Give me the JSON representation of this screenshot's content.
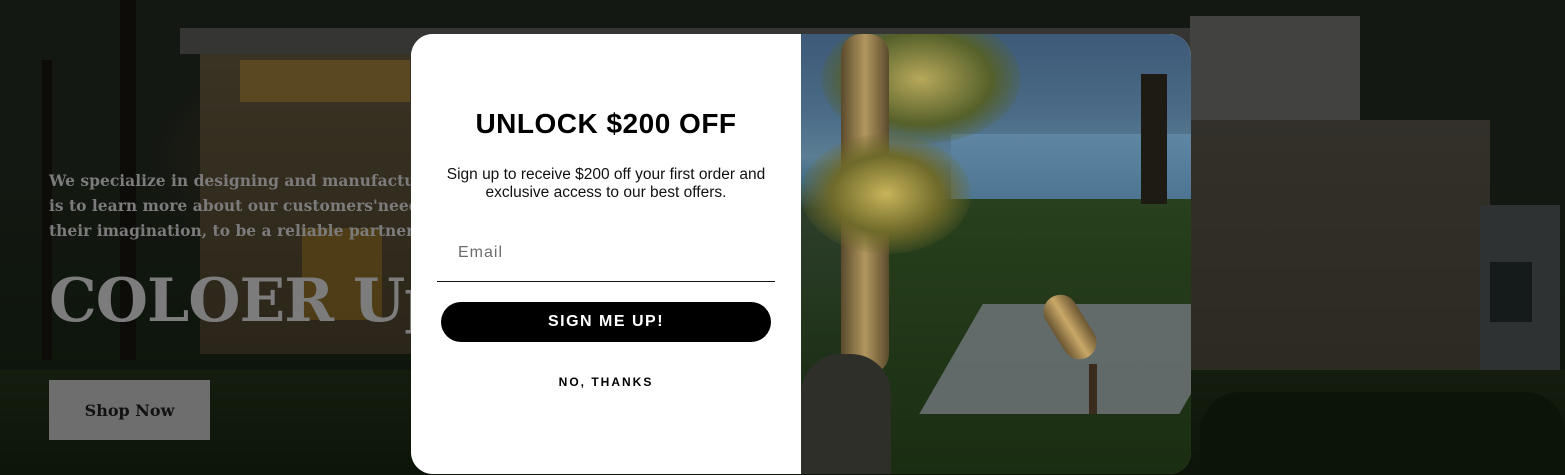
{
  "hero": {
    "text_lines": [
      "We specialize in designing and manufacturing",
      "is to learn more about our customers'needs b",
      "their imagination, to be a reliable partner in i"
    ],
    "heading": "COLOER Up",
    "shop_button": "Shop Now"
  },
  "modal": {
    "title": "UNLOCK $200 OFF",
    "subtitle": "Sign up to receive $200 off your first order and exclusive access to our best offers.",
    "email_placeholder": "Email",
    "signup_button": "SIGN ME UP!",
    "decline_link": "NO, THANKS"
  },
  "colors": {
    "modal_background": "#ffffff",
    "signup_button_background": "#000000",
    "signup_button_text": "#ffffff",
    "hero_text": "#7b7b7b",
    "shop_button_background": "#6e6e6e"
  }
}
